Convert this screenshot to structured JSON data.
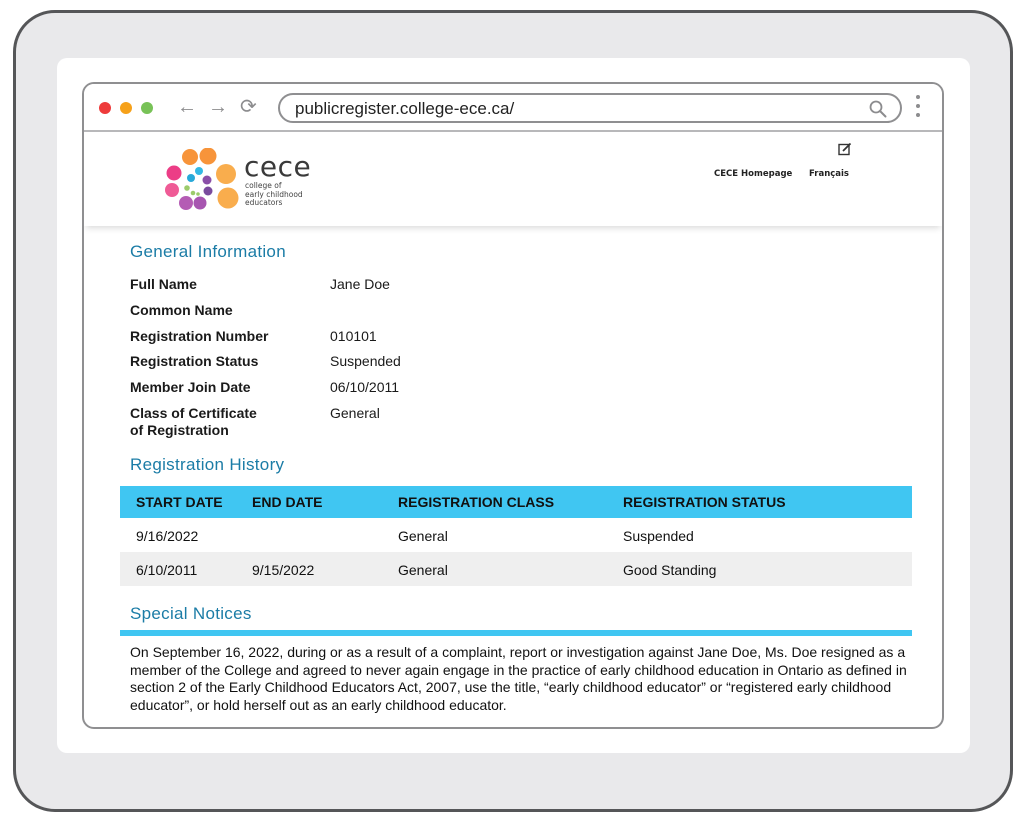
{
  "browser": {
    "url": "publicregister.college-ece.ca/",
    "window_controls": [
      "close",
      "minimize",
      "maximize"
    ],
    "nav": {
      "back_icon": "←",
      "forward_icon": "→",
      "reload_icon": "⟳"
    }
  },
  "site": {
    "logo_word": "cece",
    "logo_subtitle_1": "college of",
    "logo_subtitle_2": "early childhood",
    "logo_subtitle_3": "educators",
    "header_links": {
      "home": "CECE Homepage",
      "language": "Français"
    },
    "colors": {
      "accent_blue": "#40c6f2",
      "title_blue": "#1b7ca6"
    }
  },
  "general_information": {
    "title": "General Information",
    "fields": [
      {
        "label": "Full Name",
        "value": "Jane Doe"
      },
      {
        "label": "Common Name",
        "value": ""
      },
      {
        "label": "Registration Number",
        "value": "010101"
      },
      {
        "label": "Registration Status",
        "value": "Suspended"
      },
      {
        "label": "Member Join Date",
        "value": "06/10/2011"
      },
      {
        "label": "Class of Certificate\nof Registration",
        "value": "General"
      }
    ]
  },
  "registration_history": {
    "title": "Registration History",
    "columns": [
      "START DATE",
      "END DATE",
      "REGISTRATION CLASS",
      "REGISTRATION STATUS"
    ],
    "rows": [
      [
        "9/16/2022",
        "",
        "General",
        "Suspended"
      ],
      [
        "6/10/2011",
        "9/15/2022",
        "General",
        "Good Standing"
      ]
    ]
  },
  "special_notices": {
    "title": "Special Notices",
    "text": "On September 16, 2022, during or as a result of a complaint, report or investigation against Jane Doe, Ms. Doe resigned as a member of the College and agreed to never again engage in the practice of early childhood education in Ontario as defined in section 2 of the Early Childhood Educators Act, 2007, use the title, “early childhood educator” or “registered early childhood educator”, or hold herself out as an early childhood educator."
  }
}
